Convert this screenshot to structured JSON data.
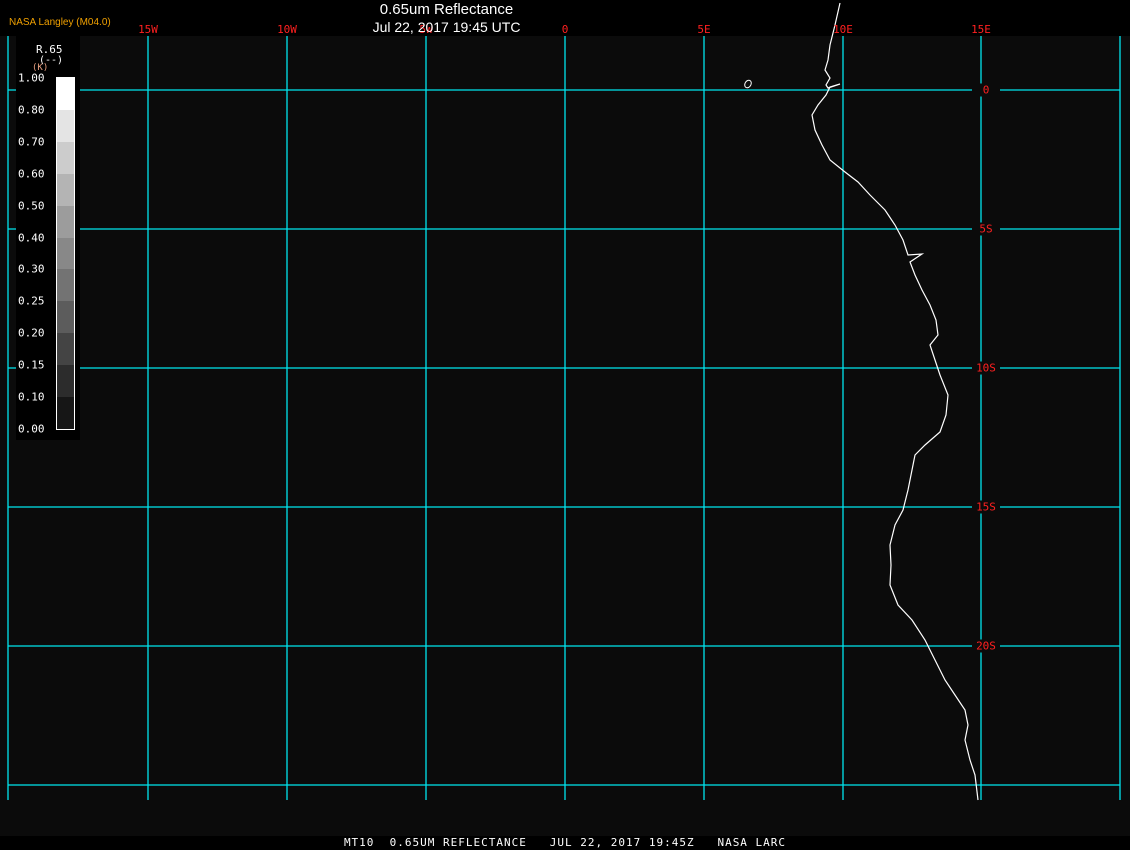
{
  "header": {
    "title": "0.65um Reflectance",
    "subtitle": "Jul 22, 2017 19:45 UTC",
    "brand": "NASA Langley (M04.0)"
  },
  "map": {
    "grid_color": "#00e5ee",
    "label_color": "#ff2020",
    "coast_color": "#ffffff",
    "longitude_labels": [
      "15W",
      "10W",
      "5W",
      "0",
      "5E",
      "10E",
      "15E"
    ],
    "latitude_labels": [
      "0",
      "5S",
      "10S",
      "15S",
      "20S"
    ]
  },
  "legend": {
    "title": "R.65",
    "units": "(--)",
    "k": "(K)",
    "ticks": [
      "1.00",
      "0.80",
      "0.70",
      "0.60",
      "0.50",
      "0.40",
      "0.30",
      "0.25",
      "0.20",
      "0.15",
      "0.10",
      "0.00"
    ],
    "colors": [
      "#ffffff",
      "#e4e4e4",
      "#cccccc",
      "#b4b4b4",
      "#9c9c9c",
      "#888888",
      "#737373",
      "#5c5c5c",
      "#444444",
      "#2c2c2c",
      "#161616"
    ]
  },
  "footer": {
    "text": "MT10  0.65UM REFLECTANCE   JUL 22, 2017 19:45Z   NASA LARC"
  }
}
